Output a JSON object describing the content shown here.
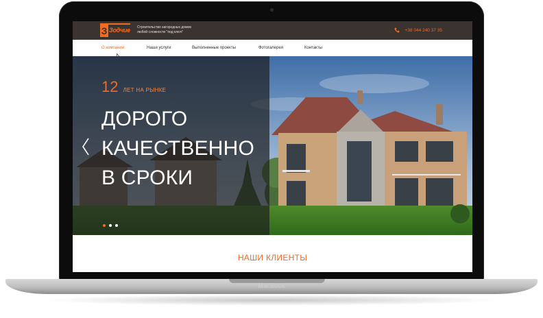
{
  "device": {
    "label": "MacBook"
  },
  "header": {
    "logo_text": "Зодчие",
    "logo_mark": "З",
    "tagline_line1": "Строительство загородных домов",
    "tagline_line2": "любой сложности \"под ключ\"",
    "phone": "+38 044 240 37 35",
    "phone_icon": "phone-icon"
  },
  "nav": {
    "items": [
      {
        "label": "О компании",
        "active": true
      },
      {
        "label": "Наши услуги",
        "active": false
      },
      {
        "label": "Выполненные проекты",
        "active": false
      },
      {
        "label": "Фотогалерея",
        "active": false
      },
      {
        "label": "Контакты",
        "active": false
      }
    ]
  },
  "hero": {
    "years_number": "12",
    "years_label": "ЛЕТ НА РЫНКЕ",
    "headline": [
      "ДОРОГО",
      "КАЧЕСТВЕННО",
      "В СРОКИ"
    ],
    "prev_icon": "chevron-left-icon",
    "slides_total": 3,
    "active_slide": 1
  },
  "clients": {
    "title": "НАШИ КЛИЕНТЫ"
  },
  "colors": {
    "accent": "#f26b22",
    "topbar": "#3a3330"
  }
}
